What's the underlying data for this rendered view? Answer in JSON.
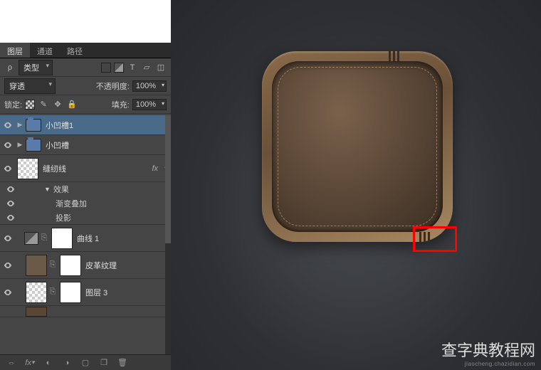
{
  "tabs": {
    "layers": "图层",
    "channels": "通道",
    "paths": "路径"
  },
  "filter": {
    "kind_label": "类型"
  },
  "blend": {
    "mode": "穿透",
    "opacity_label": "不透明度:",
    "opacity_value": "100%"
  },
  "lock": {
    "label": "锁定:",
    "fill_label": "填充:",
    "fill_value": "100%"
  },
  "layers_list": {
    "group1": "小凹槽1",
    "group2": "小凹槽",
    "stitch": "缝纫线",
    "fx_label": "fx",
    "effects": "效果",
    "grad_overlay": "渐变叠加",
    "drop_shadow": "投影",
    "curves": "曲线 1",
    "leather": "皮革纹理",
    "layer3": "图层 3"
  },
  "watermark": {
    "title": "查字典教程网",
    "url": "jiaocheng.chazidian.com"
  }
}
